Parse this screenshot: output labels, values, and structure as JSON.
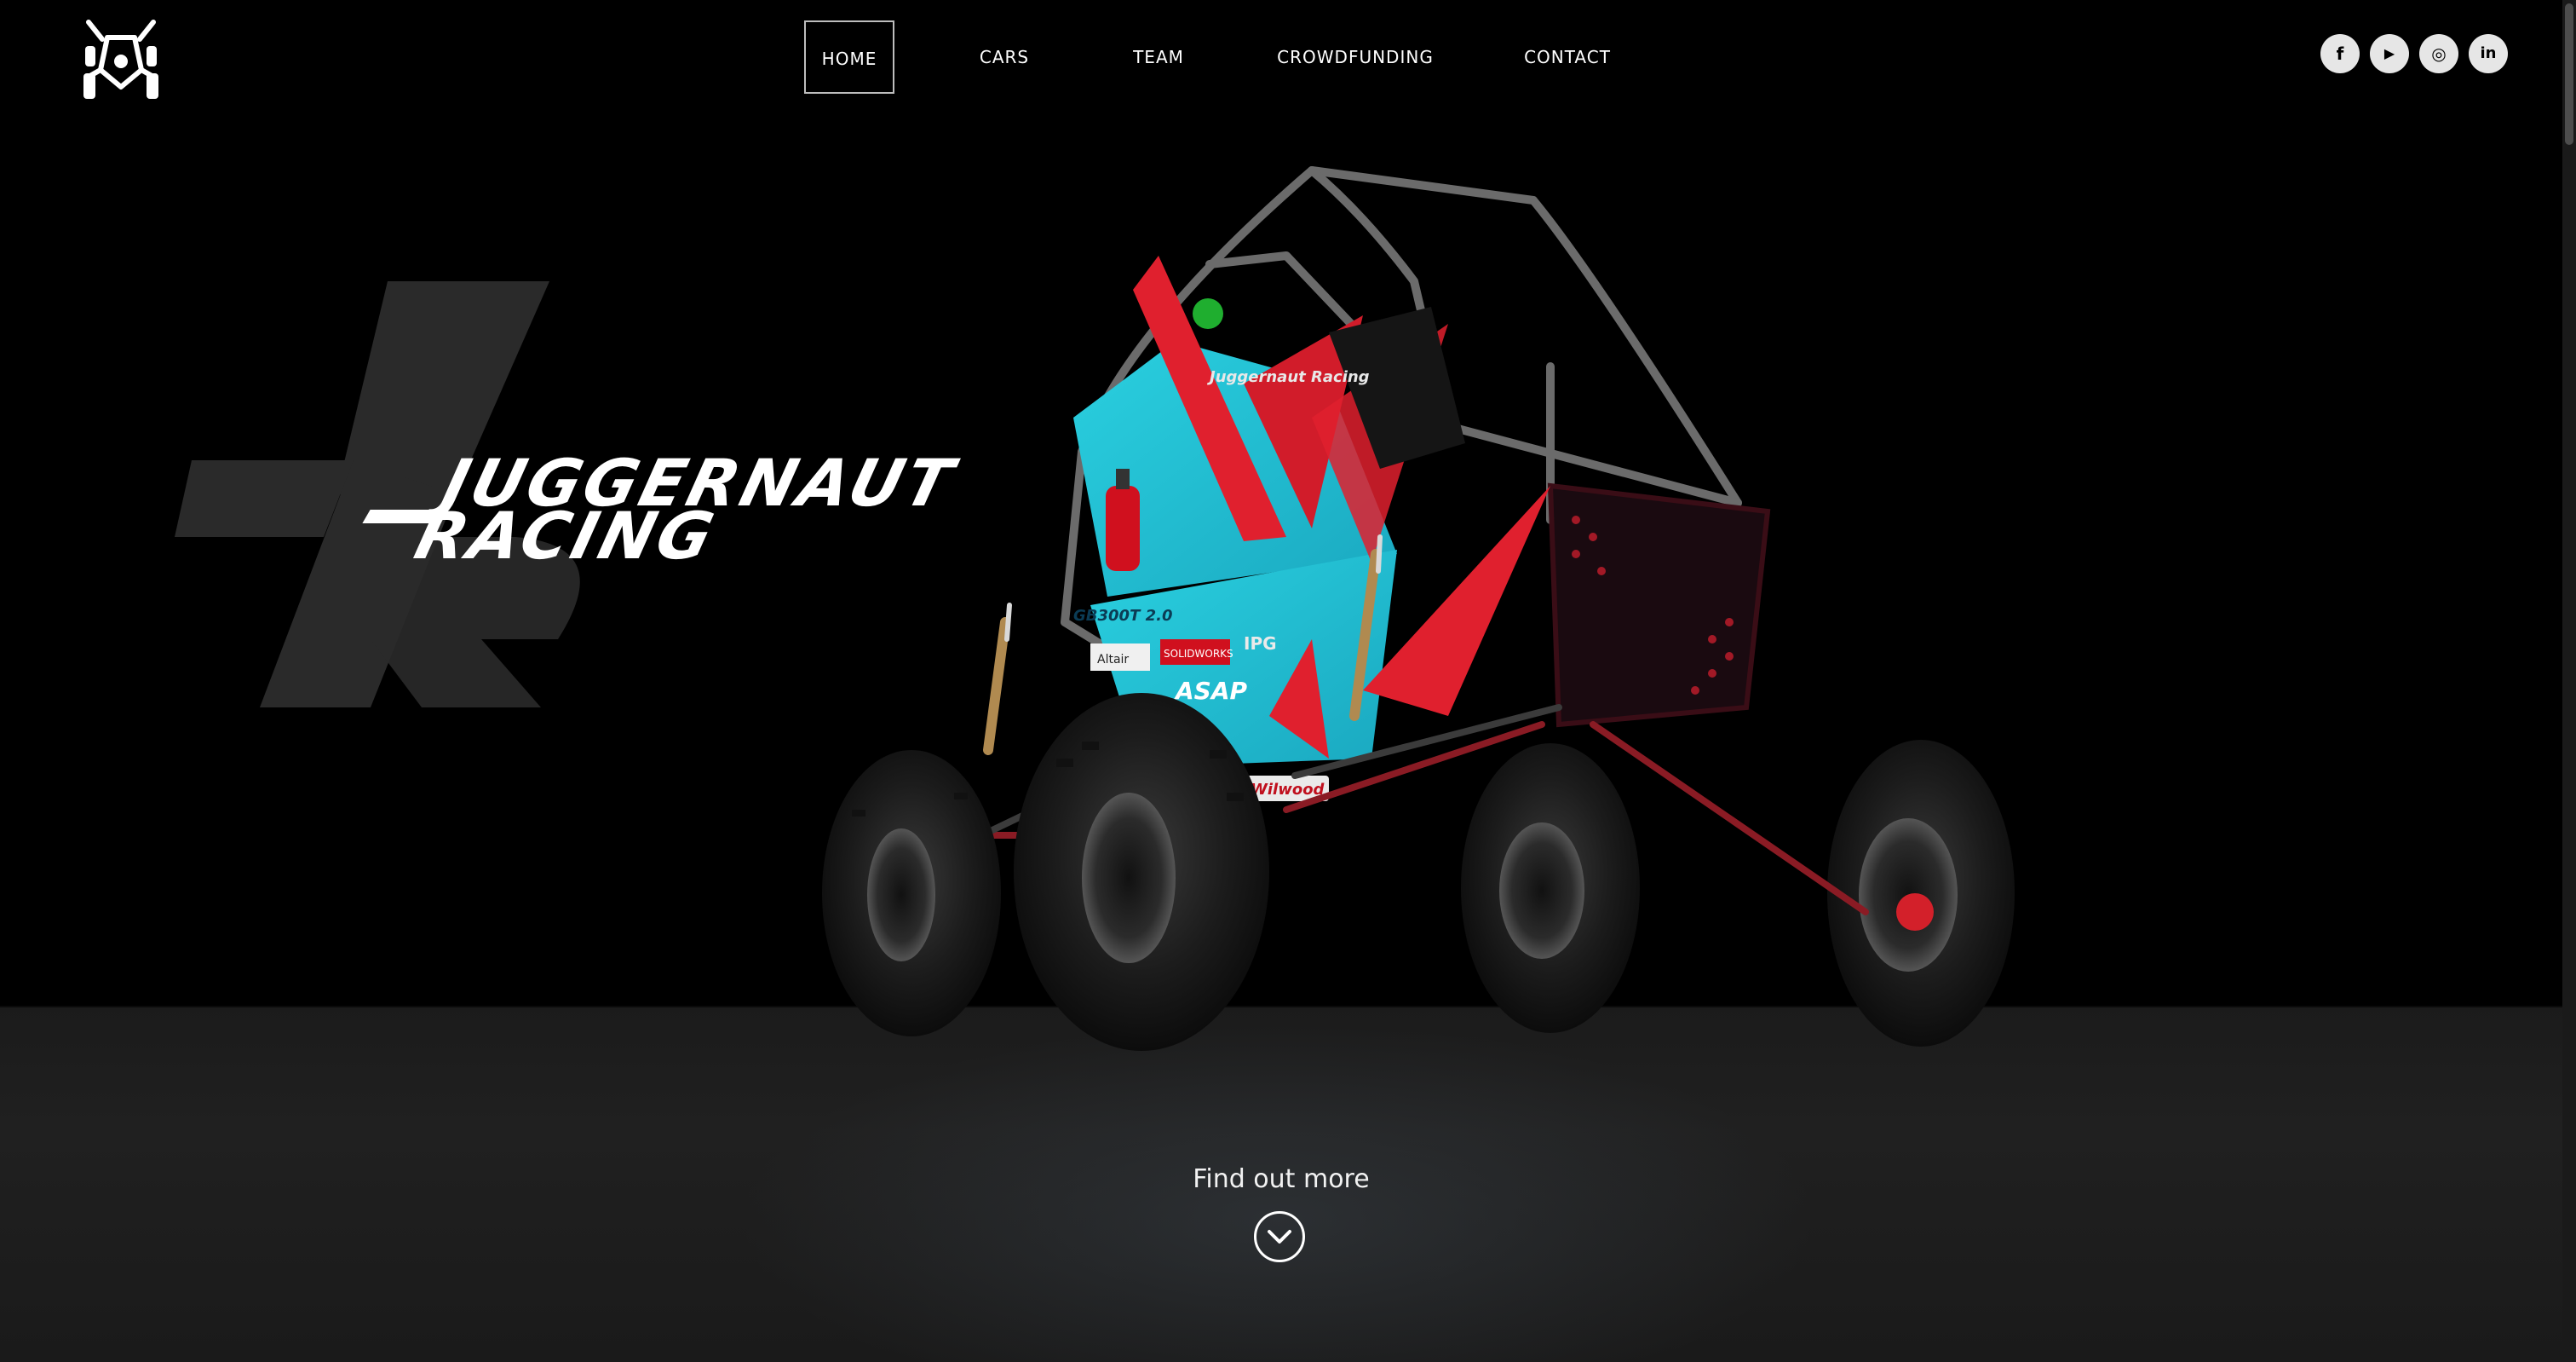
{
  "nav": {
    "items": [
      {
        "label": "HOME",
        "active": true
      },
      {
        "label": "CARS",
        "active": false
      },
      {
        "label": "TEAM",
        "active": false
      },
      {
        "label": "CROWDFUNDING",
        "active": false
      },
      {
        "label": "CONTACT",
        "active": false
      }
    ]
  },
  "socials": [
    {
      "label": "f",
      "icon": "facebook-icon"
    },
    {
      "label": "▶",
      "icon": "youtube-icon"
    },
    {
      "label": "◎",
      "icon": "instagram-icon"
    },
    {
      "label": "in",
      "icon": "linkedin-icon"
    }
  ],
  "hero": {
    "wordmark_line1": "JUGGERNAUT",
    "wordmark_line2": "RACING",
    "cta": "Find out more",
    "car_decals": [
      "Juggernaut Racing",
      "GB300T 2.0",
      "Altair",
      "SOLIDWORKS",
      "IPG",
      "ASAP",
      "Wilwood"
    ]
  },
  "colors": {
    "background": "#000000",
    "floor": "#1c1c1c",
    "livery_cyan": "#22c6d8",
    "livery_red": "#e0202e",
    "nav_text": "#ffffff"
  }
}
